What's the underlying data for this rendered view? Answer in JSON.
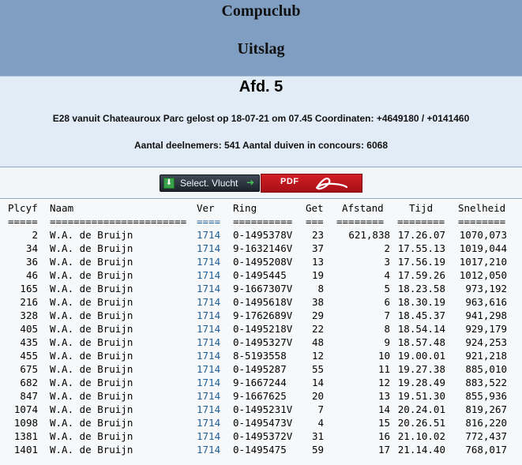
{
  "banner": {
    "title": "Compuclub",
    "subtitle": "Uitslag"
  },
  "info": {
    "afdeling": "Afd. 5",
    "flight_line": "E28 vanuit Chateauroux Parc gelost op 18-07-21 om 07.45 Coordinaten: +4649180 / +0141460",
    "participants_line": "Aantal deelnemers: 541 Aantal duiven in concours: 6068"
  },
  "buttons": {
    "select_label": "Select. Vlucht",
    "pdf_label": "PDF"
  },
  "icons": {
    "select_left": "download-arrow-icon",
    "select_right": "arrow-right-icon",
    "pdf_logo": "acrobat-logo-icon"
  },
  "colors": {
    "banner": "#7f9ec2",
    "info_panel": "#e1ecf6",
    "link_blue": "#1f5f99",
    "pdf_red": "#c8161d"
  },
  "table": {
    "headers": [
      "Plcyf",
      "Naam",
      "Ver",
      "Ring",
      "Get",
      "Afstand",
      "Tijd",
      "Snelheid"
    ],
    "separators": [
      "=====",
      "=======================",
      "====",
      "==========",
      "===",
      "========",
      "========",
      "========"
    ],
    "rows": [
      [
        "2",
        "W.A. de Bruijn",
        "1714",
        "0-1495378V",
        "23",
        "621,838",
        "17.26.07",
        "1070,073"
      ],
      [
        "34",
        "W.A. de Bruijn",
        "1714",
        "9-1632146V",
        "37",
        "2",
        "17.55.13",
        "1019,044"
      ],
      [
        "36",
        "W.A. de Bruijn",
        "1714",
        "0-1495208V",
        "13",
        "3",
        "17.56.19",
        "1017,210"
      ],
      [
        "46",
        "W.A. de Bruijn",
        "1714",
        "0-1495445",
        "19",
        "4",
        "17.59.26",
        "1012,050"
      ],
      [
        "165",
        "W.A. de Bruijn",
        "1714",
        "9-1667307V",
        "8",
        "5",
        "18.23.58",
        "973,192"
      ],
      [
        "216",
        "W.A. de Bruijn",
        "1714",
        "0-1495618V",
        "38",
        "6",
        "18.30.19",
        "963,616"
      ],
      [
        "328",
        "W.A. de Bruijn",
        "1714",
        "9-1762689V",
        "29",
        "7",
        "18.45.37",
        "941,298"
      ],
      [
        "405",
        "W.A. de Bruijn",
        "1714",
        "0-1495218V",
        "22",
        "8",
        "18.54.14",
        "929,179"
      ],
      [
        "435",
        "W.A. de Bruijn",
        "1714",
        "0-1495327V",
        "48",
        "9",
        "18.57.48",
        "924,253"
      ],
      [
        "455",
        "W.A. de Bruijn",
        "1714",
        "8-5193558",
        "12",
        "10",
        "19.00.01",
        "921,218"
      ],
      [
        "675",
        "W.A. de Bruijn",
        "1714",
        "0-1495287",
        "55",
        "11",
        "19.27.38",
        "885,010"
      ],
      [
        "682",
        "W.A. de Bruijn",
        "1714",
        "9-1667244",
        "14",
        "12",
        "19.28.49",
        "883,522"
      ],
      [
        "847",
        "W.A. de Bruijn",
        "1714",
        "9-1667625",
        "20",
        "13",
        "19.51.30",
        "855,936"
      ],
      [
        "1074",
        "W.A. de Bruijn",
        "1714",
        "0-1495231V",
        "7",
        "14",
        "20.24.01",
        "819,267"
      ],
      [
        "1098",
        "W.A. de Bruijn",
        "1714",
        "0-1495473V",
        "4",
        "15",
        "20.26.51",
        "816,220"
      ],
      [
        "1381",
        "W.A. de Bruijn",
        "1714",
        "0-1495372V",
        "31",
        "16",
        "21.10.02",
        "772,437"
      ],
      [
        "1401",
        "W.A. de Bruijn",
        "1714",
        "0-1495475",
        "59",
        "17",
        "21.14.40",
        "768,017"
      ]
    ]
  }
}
